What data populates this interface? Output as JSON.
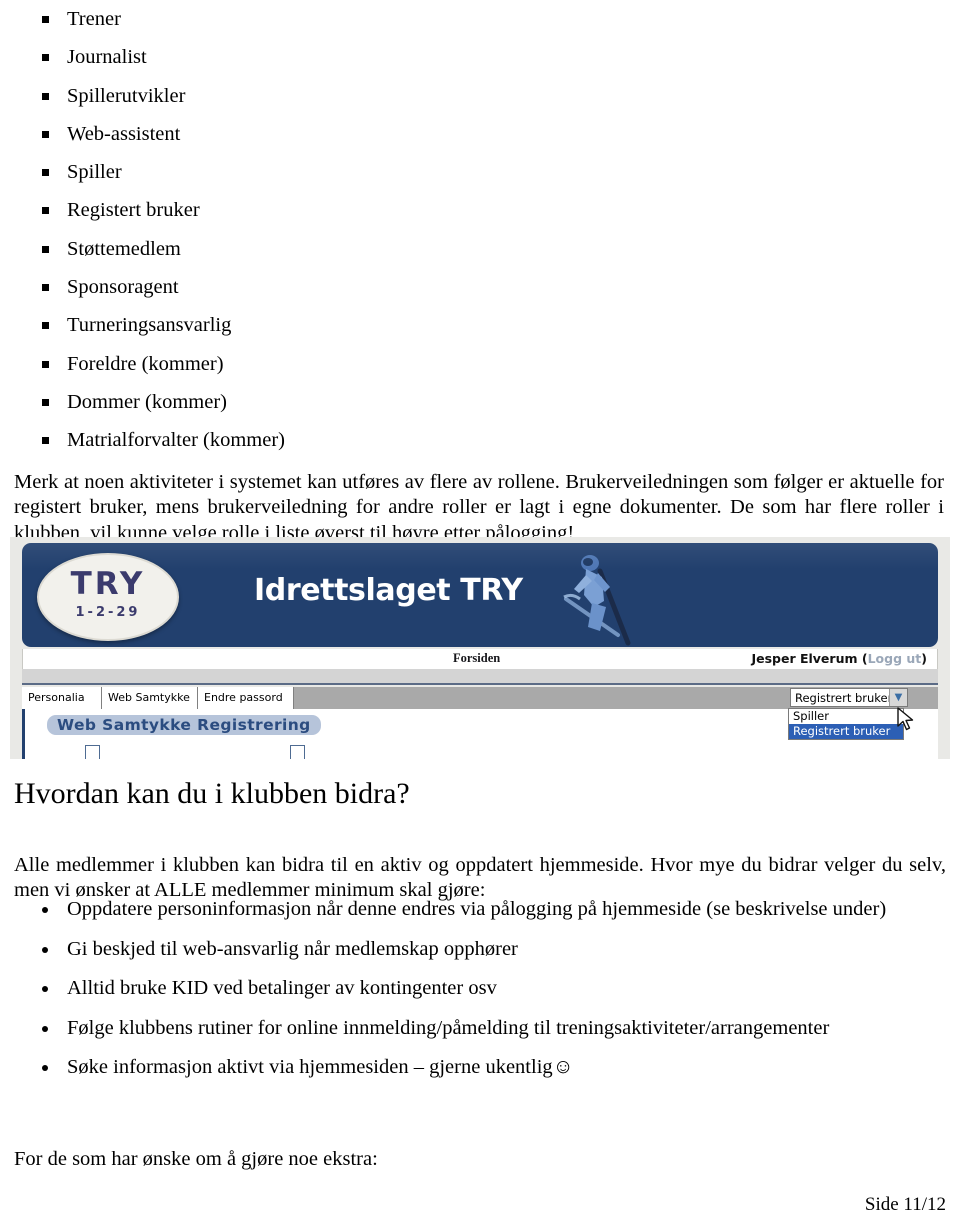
{
  "roles": {
    "items": [
      "Trener",
      "Journalist",
      "Spillerutvikler",
      "Web-assistent",
      "Spiller",
      "Registert bruker",
      "Støttemedlem",
      "Sponsoragent",
      "Turneringsansvarlig",
      "Foreldre (kommer)",
      "Dommer (kommer)",
      "Matrialforvalter (kommer)"
    ],
    "note": "Merk at noen aktiviteter i systemet kan utføres av flere av rollene. Brukerveiledningen som følger er aktuelle for registert bruker, mens brukerveiledning for andre roller er lagt i egne dokumenter. De som har flere roller i klubben, vil kunne velge rolle i liste øverst til høyre etter pålogging!"
  },
  "screenshot": {
    "logo": {
      "name": "TRY",
      "number": "1-2-29"
    },
    "banner_title": "Idrettslaget TRY",
    "nav": {
      "front_page": "Forsiden"
    },
    "user": {
      "name": "Jesper Elverum",
      "logout_open": "(",
      "logout": "Logg ut",
      "logout_close": ")"
    },
    "tabs": [
      "Personalia",
      "Web Samtykke",
      "Endre passord"
    ],
    "role_select": {
      "value": "Registrert bruker",
      "options": [
        "Spiller",
        "Registrert bruker"
      ],
      "selected_index": 1
    },
    "content_heading": "Web Samtykke Registrering",
    "colors": {
      "banner_blue": "#22406e",
      "heading_blue": "#2b4c80",
      "heading_pill": "#b6c4da",
      "select_highlight": "#2c5fb5",
      "tabbar_grey": "#a9a9a9"
    }
  },
  "contribute": {
    "heading": "Hvordan kan du i klubben bidra?",
    "intro": "Alle medlemmer i klubben kan bidra til en aktiv og oppdatert hjemmeside. Hvor mye du bidrar velger du selv, men vi ønsker at ALLE medlemmer minimum skal gjøre:",
    "items": [
      "Oppdatere personinformasjon når denne endres via pålogging på hjemmeside (se beskrivelse under)",
      "Gi beskjed til web-ansvarlig når medlemskap opphører",
      "Alltid bruke KID ved betalinger av kontingenter osv",
      "Følge klubbens rutiner for online innmelding/påmelding til treningsaktiviteter/arrangementer",
      "Søke informasjon aktivt via hjemmesiden – gjerne ukentlig☺"
    ],
    "extra_intro": "For de som har ønske om å gjøre noe ekstra:"
  },
  "footer": {
    "page": "Side 11/12"
  }
}
